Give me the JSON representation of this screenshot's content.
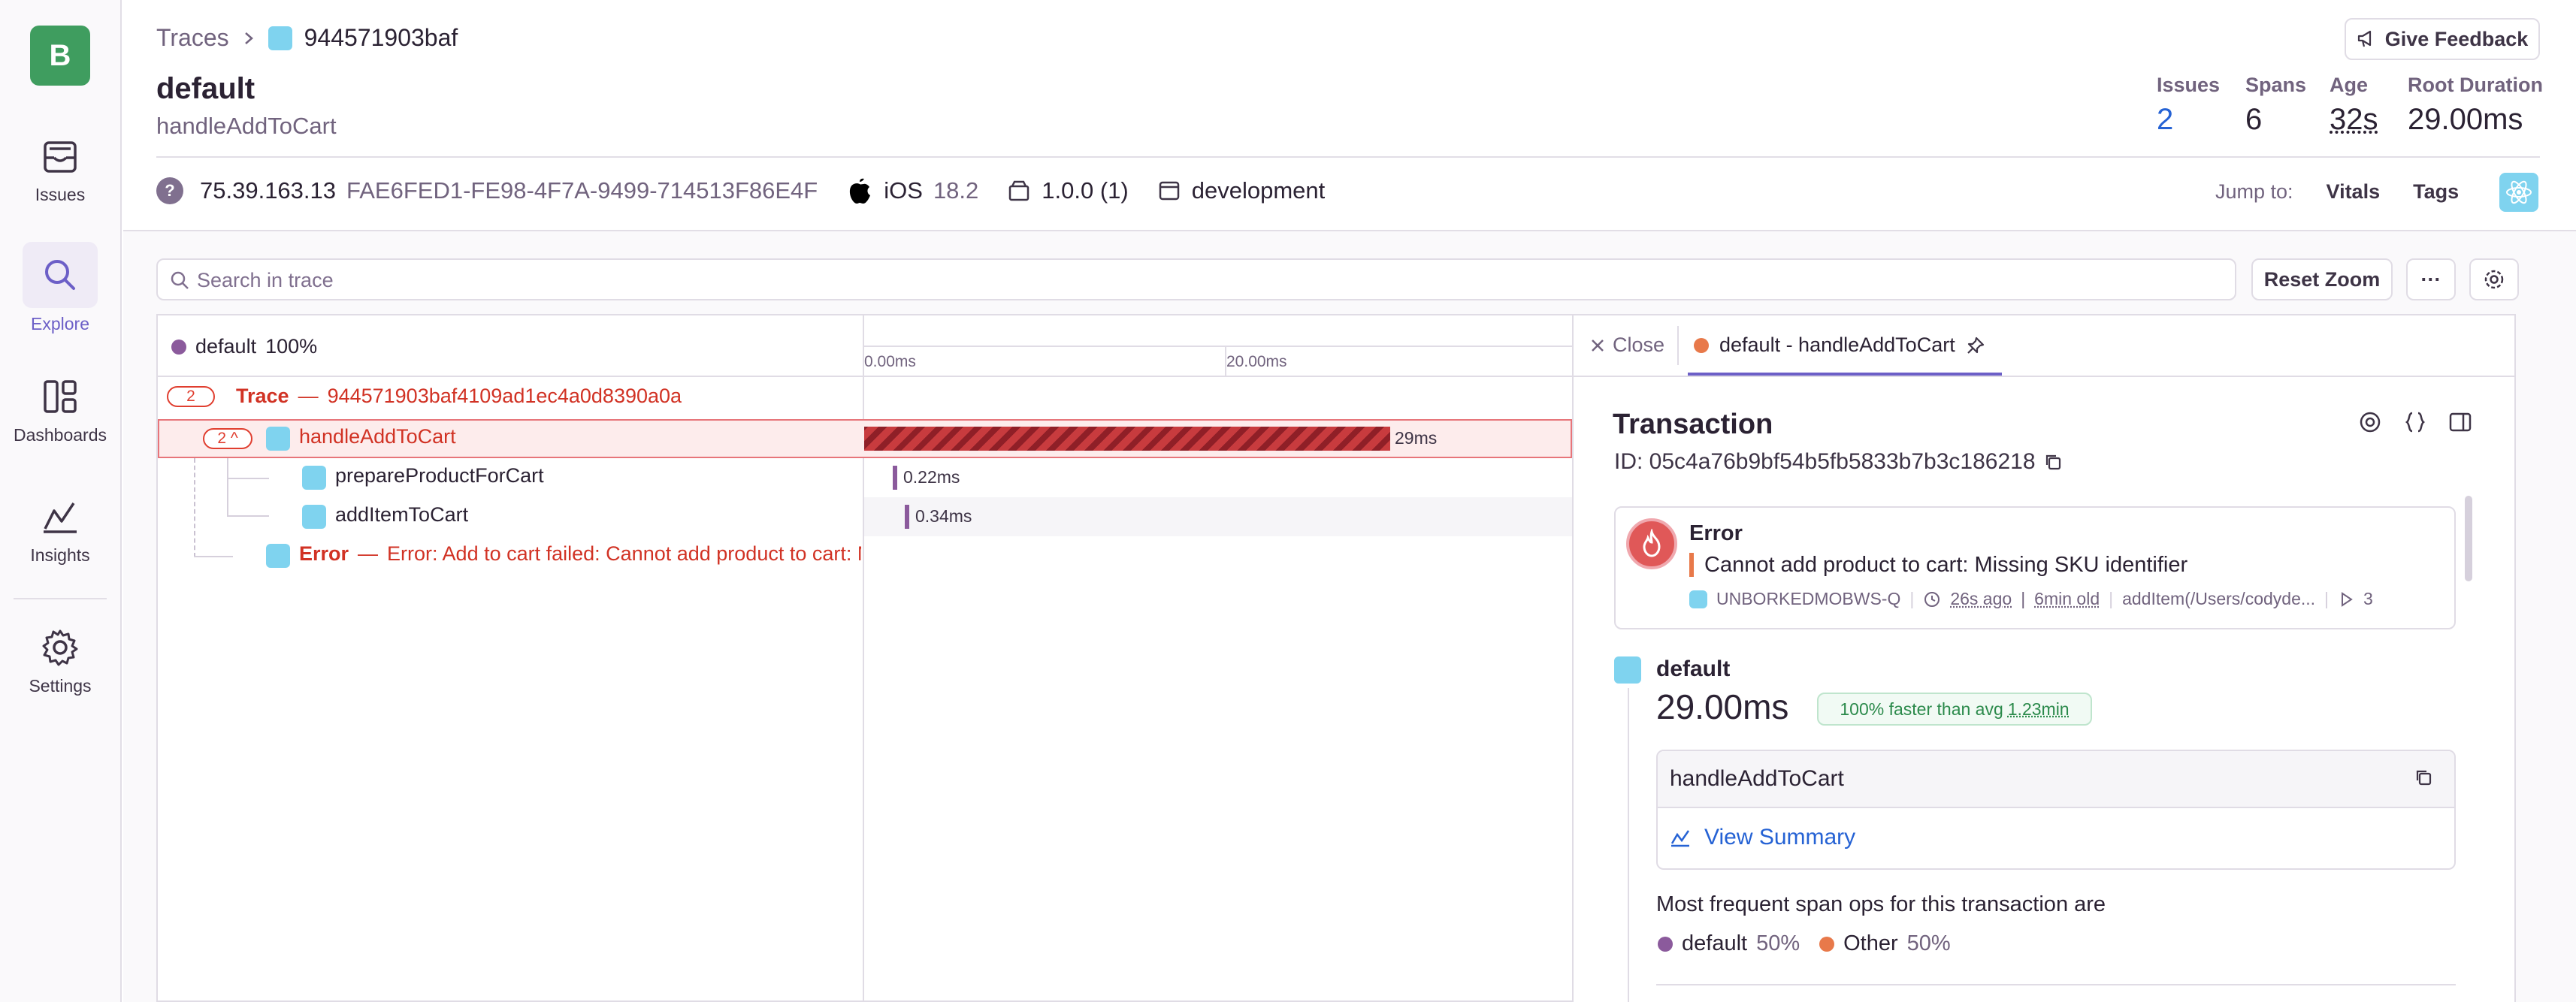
{
  "nav": {
    "org_initial": "B",
    "items": [
      {
        "label": "Issues",
        "icon": "issues-icon"
      },
      {
        "label": "Explore",
        "icon": "search-icon"
      },
      {
        "label": "Dashboards",
        "icon": "dashboards-icon"
      },
      {
        "label": "Insights",
        "icon": "insights-icon"
      },
      {
        "label": "Settings",
        "icon": "gear-icon"
      }
    ]
  },
  "header": {
    "breadcrumb_root": "Traces",
    "breadcrumb_id": "944571903baf",
    "title": "default",
    "subtitle": "handleAddToCart",
    "feedback_label": "Give Feedback",
    "stats": [
      {
        "label": "Issues",
        "value": "2"
      },
      {
        "label": "Spans",
        "value": "6"
      },
      {
        "label": "Age",
        "value": "32s"
      },
      {
        "label": "Root Duration",
        "value": "29.00ms"
      }
    ]
  },
  "meta": {
    "ip": "75.39.163.13",
    "device_id": "FAE6FED1-FE98-4F7A-9499-714513F86E4F",
    "os_name": "iOS",
    "os_version": "18.2",
    "release": "1.0.0 (1)",
    "environment": "development",
    "jump_label": "Jump to:",
    "jump_links": [
      "Vitals",
      "Tags"
    ]
  },
  "toolbar": {
    "search_placeholder": "Search in trace",
    "reset_zoom": "Reset Zoom",
    "more": "···"
  },
  "trace": {
    "header_op": "default",
    "header_pct": "100%",
    "ticks": [
      "0.00ms",
      "20.00ms"
    ],
    "trace_badge": "2",
    "trace_label": "Trace",
    "trace_dash": "—",
    "trace_id": "944571903baf4109ad1ec4a0d8390a0a",
    "root_badge": "2 ^",
    "root_name": "handleAddToCart",
    "root_duration": "29ms",
    "children": [
      {
        "name": "prepareProductForCart",
        "duration": "0.22ms"
      },
      {
        "name": "addItemToCart",
        "duration": "0.34ms"
      }
    ],
    "error_label": "Error",
    "error_dash": "—",
    "error_text": "Error: Add to cart failed: Cannot add product to cart: Missing SKU identifier"
  },
  "details": {
    "close_label": "Close",
    "tab_label": "default - handleAddToCart",
    "heading": "Transaction",
    "id_label": "ID: 05c4a76b9bf54b5fb5833b7b3c186218",
    "error": {
      "title": "Error",
      "message": "Cannot add product to cart: Missing SKU identifier",
      "project": "UNBORKEDMOBWS-Q",
      "age": "26s ago",
      "separator": "|",
      "old": "6min old",
      "culprit": "addItem(/Users/codyde...",
      "events": "3"
    },
    "op_name": "default",
    "duration": "29.00ms",
    "faster_text": "100% faster than avg",
    "faster_avg": "1.23min",
    "transaction_name": "handleAddToCart",
    "view_summary": "View Summary",
    "frequent_ops_label": "Most frequent span ops for this transaction are",
    "ops": [
      {
        "name": "default",
        "pct": "50%",
        "color": "#8b5a9c"
      },
      {
        "name": "Other",
        "pct": "50%",
        "color": "#e8794a"
      }
    ]
  },
  "colors": {
    "accent": "#6c5fc7",
    "error": "#e03e2f",
    "avatar": "#3f9d5f",
    "react": "#7fd3ef",
    "default_op": "#8b5a9c",
    "tab_dot": "#e8794a"
  }
}
